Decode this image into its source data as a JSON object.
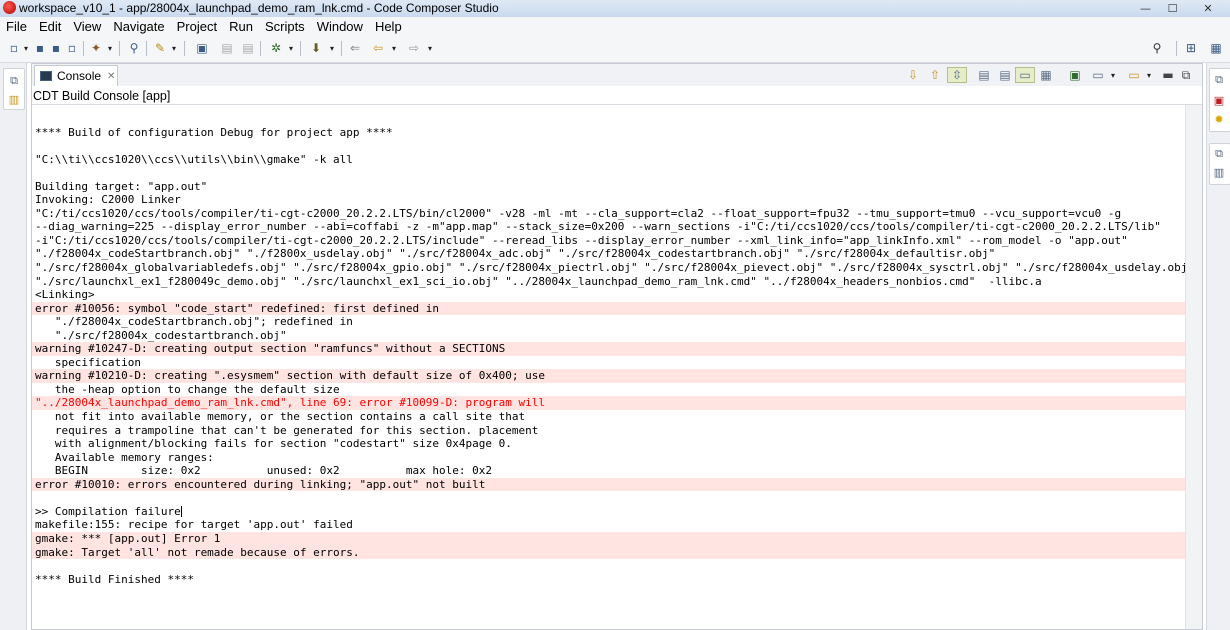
{
  "window": {
    "title": "workspace_v10_1 - app/28004x_launchpad_demo_ram_lnk.cmd - Code Composer Studio",
    "minimize": "—",
    "maximize": "☐",
    "close": "✕"
  },
  "menu": [
    "File",
    "Edit",
    "View",
    "Navigate",
    "Project",
    "Run",
    "Scripts",
    "Window",
    "Help"
  ],
  "console_view": {
    "tab_label": "Console",
    "tab_close": "✕",
    "subtitle": "CDT Build Console [app]"
  },
  "console_lines": [
    {
      "text": "",
      "kind": "normal"
    },
    {
      "text": "**** Build of configuration Debug for project app ****",
      "kind": "normal"
    },
    {
      "text": "",
      "kind": "normal"
    },
    {
      "text": "\"C:\\\\ti\\\\ccs1020\\\\ccs\\\\utils\\\\bin\\\\gmake\" -k all",
      "kind": "normal"
    },
    {
      "text": "",
      "kind": "normal"
    },
    {
      "text": "Building target: \"app.out\"",
      "kind": "normal"
    },
    {
      "text": "Invoking: C2000 Linker",
      "kind": "normal"
    },
    {
      "text": "\"C:/ti/ccs1020/ccs/tools/compiler/ti-cgt-c2000_20.2.2.LTS/bin/cl2000\" -v28 -ml -mt --cla_support=cla2 --float_support=fpu32 --tmu_support=tmu0 --vcu_support=vcu0 -g",
      "kind": "normal"
    },
    {
      "text": "--diag_warning=225 --display_error_number --abi=coffabi -z -m\"app.map\" --stack_size=0x200 --warn_sections -i\"C:/ti/ccs1020/ccs/tools/compiler/ti-cgt-c2000_20.2.2.LTS/lib\"",
      "kind": "normal"
    },
    {
      "text": "-i\"C:/ti/ccs1020/ccs/tools/compiler/ti-cgt-c2000_20.2.2.LTS/include\" --reread_libs --display_error_number --xml_link_info=\"app_linkInfo.xml\" --rom_model -o \"app.out\"",
      "kind": "normal"
    },
    {
      "text": "\"./f28004x_codeStartbranch.obj\" \"./f2800x_usdelay.obj\" \"./src/f28004x_adc.obj\" \"./src/f28004x_codestartbranch.obj\" \"./src/f28004x_defaultisr.obj\"",
      "kind": "normal"
    },
    {
      "text": "\"./src/f28004x_globalvariabledefs.obj\" \"./src/f28004x_gpio.obj\" \"./src/f28004x_piectrl.obj\" \"./src/f28004x_pievect.obj\" \"./src/f28004x_sysctrl.obj\" \"./src/f28004x_usdelay.obj\"",
      "kind": "normal"
    },
    {
      "text": "\"./src/launchxl_ex1_f280049c_demo.obj\" \"./src/launchxl_ex1_sci_io.obj\" \"../28004x_launchpad_demo_ram_lnk.cmd\" \"../f28004x_headers_nonbios.cmd\"  -llibc.a",
      "kind": "normal"
    },
    {
      "text": "<Linking>",
      "kind": "normal"
    },
    {
      "text": "error #10056: symbol \"code_start\" redefined: first defined in",
      "kind": "err"
    },
    {
      "text": "   \"./f28004x_codeStartbranch.obj\"; redefined in",
      "kind": "normal"
    },
    {
      "text": "   \"./src/f28004x_codestartbranch.obj\"",
      "kind": "normal"
    },
    {
      "text": "warning #10247-D: creating output section \"ramfuncs\" without a SECTIONS",
      "kind": "err"
    },
    {
      "text": "   specification",
      "kind": "normal"
    },
    {
      "text": "warning #10210-D: creating \".esysmem\" section with default size of 0x400; use",
      "kind": "err"
    },
    {
      "text": "   the -heap option to change the default size",
      "kind": "normal"
    },
    {
      "text": "\"../28004x_launchpad_demo_ram_lnk.cmd\", line 69: error #10099-D: program will",
      "kind": "err-red"
    },
    {
      "text": "   not fit into available memory, or the section contains a call site that",
      "kind": "normal"
    },
    {
      "text": "   requires a trampoline that can't be generated for this section. placement",
      "kind": "normal"
    },
    {
      "text": "   with alignment/blocking fails for section \"codestart\" size 0x4page 0.",
      "kind": "normal"
    },
    {
      "text": "   Available memory ranges:",
      "kind": "normal"
    },
    {
      "text": "   BEGIN        size: 0x2          unused: 0x2          max hole: 0x2",
      "kind": "normal"
    },
    {
      "text": "error #10010: errors encountered during linking; \"app.out\" not built",
      "kind": "err"
    },
    {
      "text": "",
      "kind": "normal"
    },
    {
      "text": ">> Compilation failure",
      "kind": "caret"
    },
    {
      "text": "makefile:155: recipe for target 'app.out' failed",
      "kind": "normal"
    },
    {
      "text": "gmake: *** [app.out] Error 1",
      "kind": "err"
    },
    {
      "text": "gmake: Target 'all' not remade because of errors.",
      "kind": "err"
    },
    {
      "text": "",
      "kind": "normal"
    },
    {
      "text": "**** Build Finished ****",
      "kind": "normal"
    }
  ],
  "colors": {
    "error_background": "#ffe4e1",
    "error_text": "#ff0000"
  }
}
